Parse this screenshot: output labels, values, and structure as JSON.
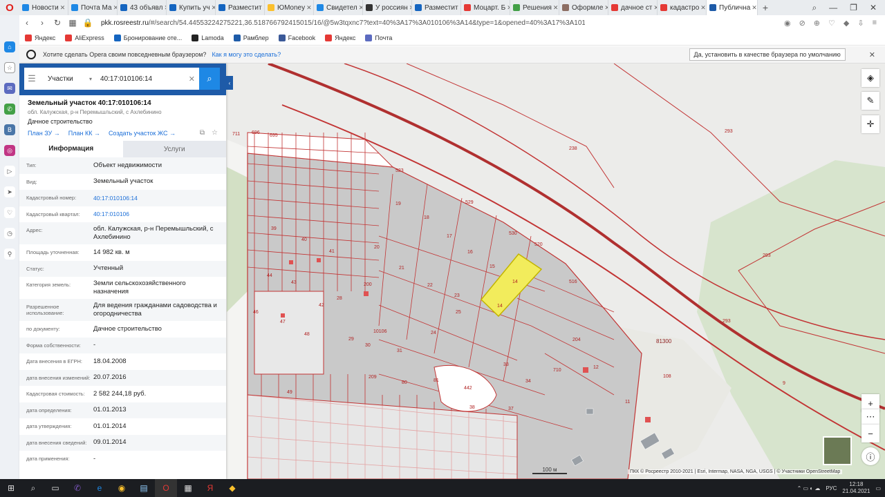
{
  "browser": {
    "tabs": [
      {
        "label": "Новости",
        "color": "#1e88e5"
      },
      {
        "label": "Почта Ма",
        "color": "#1e88e5"
      },
      {
        "label": "43 объявл",
        "color": "#1565c0"
      },
      {
        "label": "Купить уч",
        "color": "#1565c0"
      },
      {
        "label": "Разместит",
        "color": "#1565c0"
      },
      {
        "label": "ЮMoney",
        "color": "#fbc02d"
      },
      {
        "label": "Свидетел",
        "color": "#1e88e5"
      },
      {
        "label": "У россиян",
        "color": "#333333"
      },
      {
        "label": "Разместит",
        "color": "#1565c0"
      },
      {
        "label": "Моцарт. Б",
        "color": "#e53935"
      },
      {
        "label": "Решения",
        "color": "#43a047"
      },
      {
        "label": "Оформле",
        "color": "#8d6e63"
      },
      {
        "label": "дачное ст",
        "color": "#e53935"
      },
      {
        "label": "кадастро",
        "color": "#e53935"
      },
      {
        "label": "Публична",
        "color": "#1e5ba8"
      }
    ],
    "new_tab": "+",
    "url_domain": "pkk.rosreestr.ru",
    "url_rest": "/#/search/54.44553224275221,36.518766792415015/16/@5w3tqxnc7?text=40%3A17%3A010106%3A14&type=1&opened=40%3A17%3A10106%3A14",
    "bookmarks": [
      {
        "label": "Яндекс",
        "color": "#e53935"
      },
      {
        "label": "AliExpress",
        "color": "#e53935"
      },
      {
        "label": "Бронирование оте...",
        "color": "#1565c0"
      },
      {
        "label": "Lamoda",
        "color": "#222222"
      },
      {
        "label": "Рамблер",
        "color": "#1e5ba8"
      },
      {
        "label": "Facebook",
        "color": "#3b5998"
      },
      {
        "label": "Яндекс",
        "color": "#e53935"
      },
      {
        "label": "Почта",
        "color": "#5c6bc0"
      }
    ],
    "prompt_text": "Хотите сделать Opera своим повседневным браузером?",
    "prompt_link": "Как я могу это сделать?",
    "prompt_button": "Да, установить в качестве браузера по умолчанию"
  },
  "search": {
    "category": "Участки",
    "query": "40:17:010106:14"
  },
  "parcel": {
    "title": "Земельный участок 40:17:010106:14",
    "address_short": "обл. Калужская, р-н Перемышльский, с Ахлебинино",
    "purpose": "Дачное строительство",
    "links": [
      "План ЗУ →",
      "План КК →",
      "Создать участок ЖС →"
    ],
    "tabs": [
      "Информация",
      "Услуги"
    ],
    "fields": [
      {
        "k": "Тип:",
        "v": "Объект недвижимости"
      },
      {
        "k": "Вид:",
        "v": "Земельный участок"
      },
      {
        "k": "Кадастровый номер:",
        "v": "40:17:010106:14",
        "link": true
      },
      {
        "k": "Кадастровый квартал:",
        "v": "40:17:010106",
        "link": true
      },
      {
        "k": "Адрес:",
        "v": "обл. Калужская, р-н Перемышльский, с Ахлебинино"
      },
      {
        "k": "Площадь уточненная:",
        "v": "14 982 кв. м"
      },
      {
        "k": "Статус:",
        "v": "Учтенный"
      },
      {
        "k": "Категория земель:",
        "v": "Земли сельскохозяйственного назначения"
      },
      {
        "k": "Разрешенное использование:",
        "v": "Для ведения гражданами садоводства и огородничества"
      },
      {
        "k": "по документу:",
        "v": "Дачное строительство"
      },
      {
        "k": "Форма собственности:",
        "v": "-"
      },
      {
        "k": "Дата внесения в ЕГРН:",
        "v": "18.04.2008"
      },
      {
        "k": "дата внесения изменений:",
        "v": "20.07.2016"
      },
      {
        "k": "Кадастровая стоимость:",
        "v": "2 582 244,18 руб."
      },
      {
        "k": "дата определения:",
        "v": "01.01.2013"
      },
      {
        "k": "дата утверждения:",
        "v": "01.01.2014"
      },
      {
        "k": "дата внесения сведений:",
        "v": "09.01.2014"
      },
      {
        "k": "дата применения:",
        "v": "-"
      }
    ]
  },
  "map": {
    "labels": [
      "293",
      "238",
      "293",
      "293",
      "9",
      "81300",
      "108",
      "11",
      "12",
      "14",
      "14",
      "10106",
      "200",
      "442",
      "523",
      "529",
      "530",
      "520",
      "516",
      "19",
      "18",
      "17",
      "16",
      "15",
      "20",
      "21",
      "22",
      "23",
      "24",
      "25",
      "31",
      "33",
      "34",
      "37",
      "38",
      "41",
      "39",
      "40",
      "42",
      "43",
      "44",
      "46",
      "47",
      "48",
      "49",
      "28",
      "29",
      "30",
      "80",
      "81",
      "209",
      "204",
      "710",
      "711",
      "696",
      "695"
    ],
    "scale": "100 м",
    "attribution": "ПКК © Росреестр 2010-2021 | Esri, Intermap, NASA, NGA, USGS | © Участники OpenStreetMap"
  },
  "taskbar": {
    "lang": "РУС",
    "time": "12:18",
    "date": "21.04.2021"
  }
}
